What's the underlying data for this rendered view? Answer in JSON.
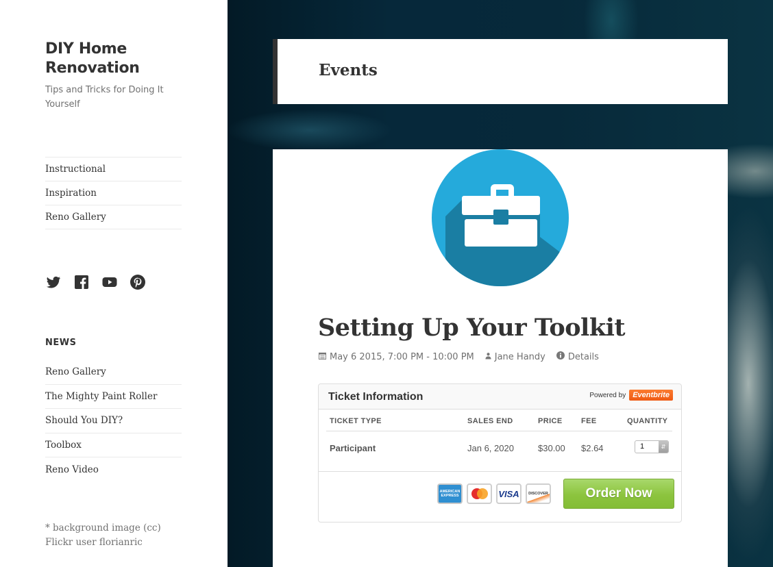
{
  "site": {
    "title": "DIY Home Renovation",
    "description": "Tips and Tricks for Doing It Yourself"
  },
  "menu": [
    {
      "label": "Instructional"
    },
    {
      "label": "Inspiration"
    },
    {
      "label": "Reno Gallery"
    }
  ],
  "social": [
    {
      "icon": "twitter-icon"
    },
    {
      "icon": "facebook-icon"
    },
    {
      "icon": "youtube-icon"
    },
    {
      "icon": "pinterest-icon"
    }
  ],
  "news_widget": {
    "title": "NEWS",
    "items": [
      {
        "label": "Reno Gallery"
      },
      {
        "label": "The Mighty Paint Roller"
      },
      {
        "label": "Should You DIY?"
      },
      {
        "label": "Toolbox"
      },
      {
        "label": "Reno Video"
      }
    ]
  },
  "credit": "* background image (cc) Flickr user florianric",
  "page": {
    "title": "Events"
  },
  "event": {
    "icon": "toolbox-icon",
    "icon_color": "#25aadb",
    "title": "Setting Up Your Toolkit",
    "date": "May 6 2015, 7:00 PM - 10:00 PM",
    "organizer": "Jane Handy",
    "details_label": "Details"
  },
  "ticket_widget": {
    "title": "Ticket Information",
    "powered_by": "Powered by",
    "brand": "Eventbrite",
    "brand_color": "#f26522",
    "columns": [
      "TICKET TYPE",
      "SALES END",
      "PRICE",
      "FEE",
      "QUANTITY"
    ],
    "rows": [
      {
        "type": "Participant",
        "sales_end": "Jan 6, 2020",
        "price": "$30.00",
        "fee": "$2.64",
        "quantity": "1"
      }
    ],
    "payment_methods": [
      "AMERICAN EXPRESS",
      "MasterCard",
      "VISA",
      "DISCOVER"
    ],
    "order_button": "Order Now",
    "order_color": "#8cc43e"
  }
}
